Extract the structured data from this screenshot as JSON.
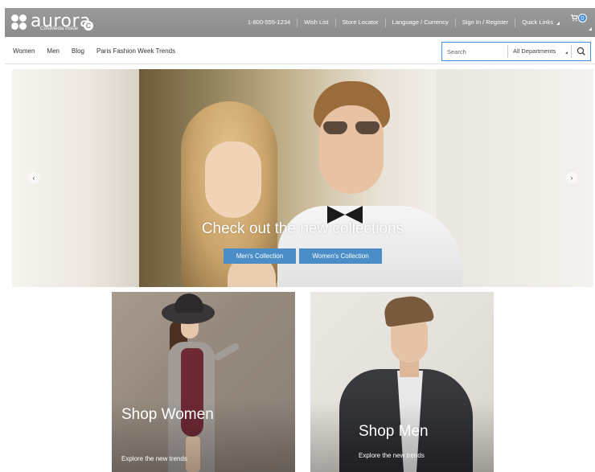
{
  "header": {
    "logo": {
      "word": "aurora",
      "sub": "CoreMedia Inside",
      "badge": "C"
    },
    "links": [
      {
        "label": "1-800-555-1234"
      },
      {
        "label": "Wish List"
      },
      {
        "label": "Store Locator"
      },
      {
        "label": "Language / Currency"
      },
      {
        "label": "Sign In / Register"
      },
      {
        "label": "Quick Links"
      }
    ],
    "cart": {
      "count": "0",
      "icon": "cart-icon"
    }
  },
  "nav": {
    "items": [
      "Women",
      "Men",
      "Blog",
      "Paris Fashion Week Trends"
    ]
  },
  "search": {
    "placeholder": "Search",
    "department": "All Departments",
    "icon": "search-icon"
  },
  "hero": {
    "headline": "Check out the new collections",
    "buttons": {
      "men": "Men's Collection",
      "women": "Women's Collection"
    },
    "prev": "‹",
    "next": "›"
  },
  "tiles": {
    "women": {
      "title": "Shop Women",
      "subtitle": "Explore the new trends"
    },
    "men": {
      "title": "Shop Men",
      "subtitle": "Explore the new trends"
    }
  },
  "colors": {
    "header_bg": "#8f8f8f",
    "accent": "#4b8ec7"
  }
}
